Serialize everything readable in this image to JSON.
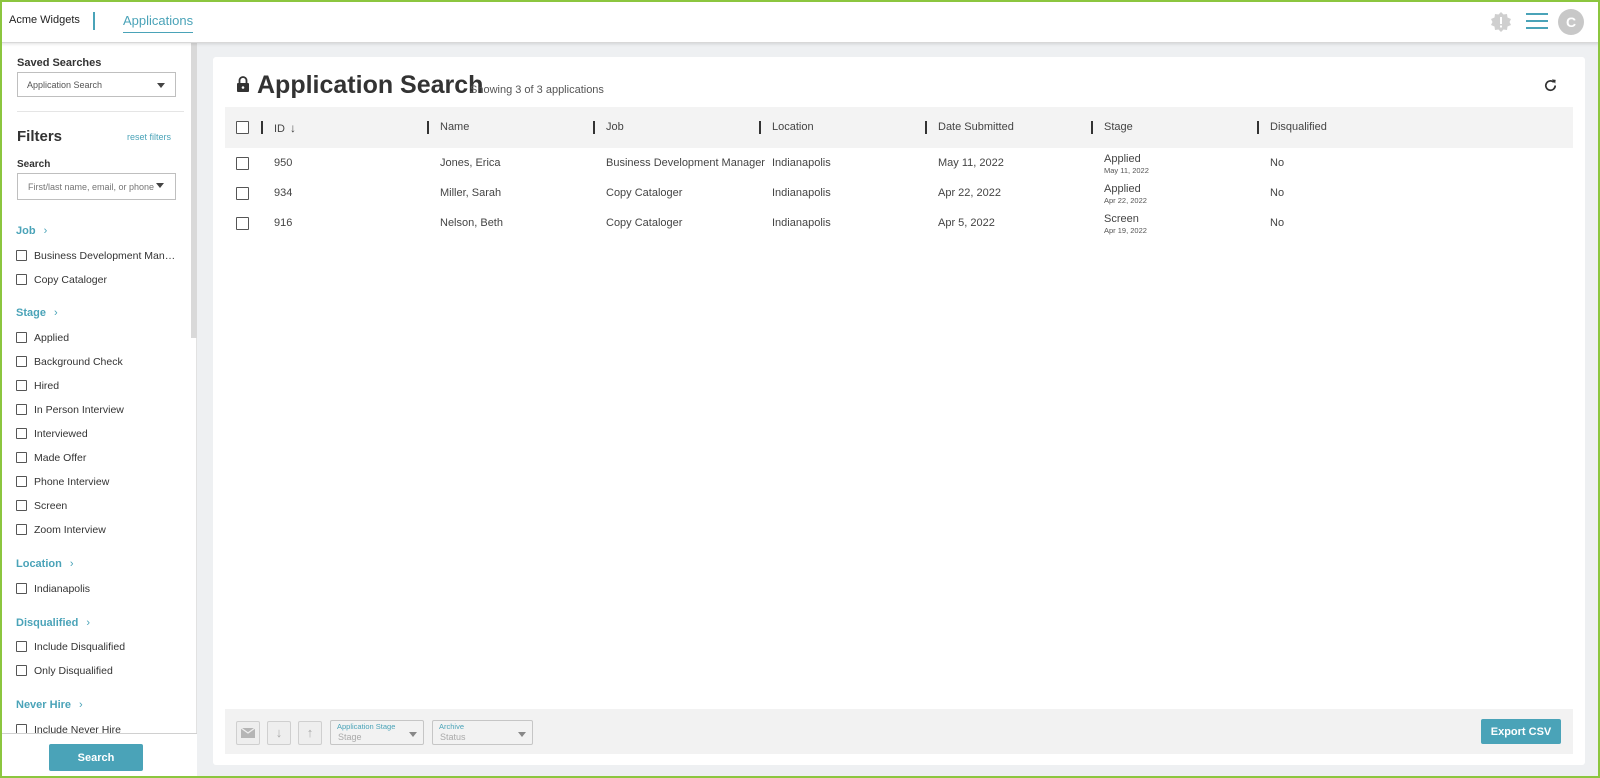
{
  "header": {
    "brand": "Acme Widgets",
    "tab": "Applications",
    "avatar_initial": "C",
    "accent": "#4aa3b8"
  },
  "sidebar": {
    "saved_label": "Saved Searches",
    "saved_value": "Application Search",
    "filters_title": "Filters",
    "reset_label": "reset filters",
    "search_label": "Search",
    "search_placeholder": "First/last name, email, or phone",
    "sections": {
      "job": {
        "title": "Job",
        "options": [
          "Business Development Manager",
          "Copy Cataloger"
        ]
      },
      "stage": {
        "title": "Stage",
        "options": [
          "Applied",
          "Background Check",
          "Hired",
          "In Person Interview",
          "Interviewed",
          "Made Offer",
          "Phone Interview",
          "Screen",
          "Zoom Interview"
        ]
      },
      "location": {
        "title": "Location",
        "options": [
          "Indianapolis"
        ]
      },
      "disqualified": {
        "title": "Disqualified",
        "options": [
          "Include Disqualified",
          "Only Disqualified"
        ]
      },
      "never_hire": {
        "title": "Never Hire",
        "options": [
          "Include Never Hire"
        ]
      }
    },
    "search_button": "Search"
  },
  "main": {
    "title": "Application Search",
    "subtitle": "Showing 3 of 3 applications",
    "columns": [
      "ID",
      "Name",
      "Job",
      "Location",
      "Date Submitted",
      "Stage",
      "Disqualified"
    ],
    "rows": [
      {
        "id": "950",
        "name": "Jones, Erica",
        "job": "Business Development Manager",
        "location": "Indianapolis",
        "date": "May 11, 2022",
        "stage": "Applied",
        "stage_date": "May 11, 2022",
        "disqualified": "No"
      },
      {
        "id": "934",
        "name": "Miller, Sarah",
        "job": "Copy Cataloger",
        "location": "Indianapolis",
        "date": "Apr 22, 2022",
        "stage": "Applied",
        "stage_date": "Apr 22, 2022",
        "disqualified": "No"
      },
      {
        "id": "916",
        "name": "Nelson, Beth",
        "job": "Copy Cataloger",
        "location": "Indianapolis",
        "date": "Apr 5, 2022",
        "stage": "Screen",
        "stage_date": "Apr 19, 2022",
        "disqualified": "No"
      }
    ],
    "actions": {
      "stage_label": "Application Stage",
      "stage_placeholder": "Stage",
      "archive_label": "Archive",
      "archive_placeholder": "Status",
      "export_label": "Export CSV"
    }
  }
}
